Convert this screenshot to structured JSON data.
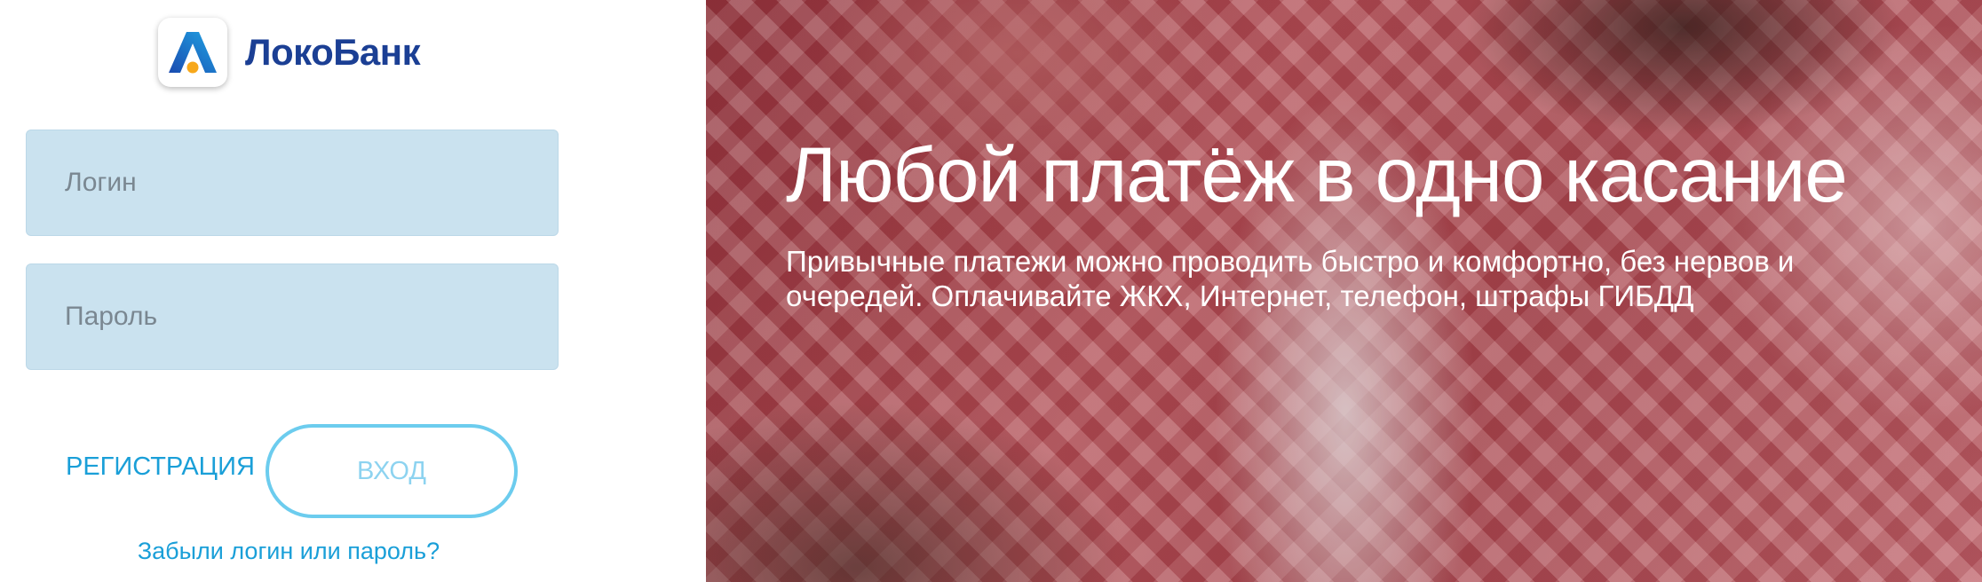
{
  "brand": {
    "name": "ЛокоБанк",
    "logo_icon": "lokobank-logo-icon",
    "colors": {
      "primary": "#1b3f94",
      "accent": "#1a9fd8",
      "field": "#cae2ef",
      "button_border": "#6cccee"
    }
  },
  "login": {
    "login_placeholder": "Логин",
    "password_placeholder": "Пароль",
    "register_label": "РЕГИСТРАЦИЯ",
    "enter_label": "ВХОД",
    "forgot_label": "Забыли логин или пароль?"
  },
  "promo": {
    "title": "Любой платёж в одно касание",
    "text": "Привычные платежи можно проводить быстро и комфортно, без нервов и очередей. Оплачивайте ЖКХ, Интернет, телефон, штрафы ГИБДД"
  }
}
